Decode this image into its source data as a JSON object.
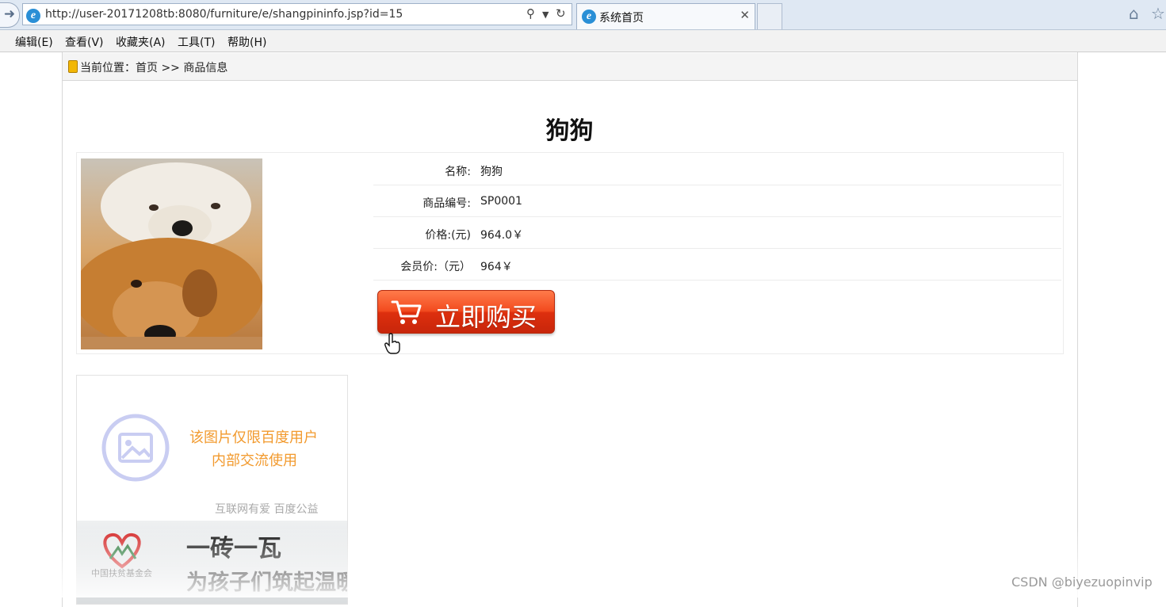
{
  "browser": {
    "url": "http://user-20171208tb:8080/furniture/e/shangpininfo.jsp?id=15",
    "tab_title": "系统首页",
    "menu": [
      "编辑(E)",
      "查看(V)",
      "收藏夹(A)",
      "工具(T)",
      "帮助(H)"
    ]
  },
  "breadcrumb": {
    "text": "当前位置：首页 >> 商品信息"
  },
  "product": {
    "title": "狗狗",
    "fields": [
      {
        "label": "名称:",
        "value": "狗狗"
      },
      {
        "label": "商品编号:",
        "value": "SP0001"
      },
      {
        "label": "价格:(元)",
        "value": "964.0￥"
      },
      {
        "label": "会员价:（元）",
        "value": "964￥"
      }
    ],
    "buy_label": "立即购买"
  },
  "ad": {
    "line1": "该图片仅限百度用户",
    "line2": "内部交流使用",
    "sub": "互联网有爱  百度公益",
    "logo_text": "中国扶贫基金会",
    "headline": "一砖一瓦",
    "headline2": "为孩子们筑起温暖的宿舍"
  },
  "watermark": "CSDN @biyezuopinvip",
  "colors": {
    "accent": "#f24b1f",
    "ad_orange": "#f29a2e"
  }
}
